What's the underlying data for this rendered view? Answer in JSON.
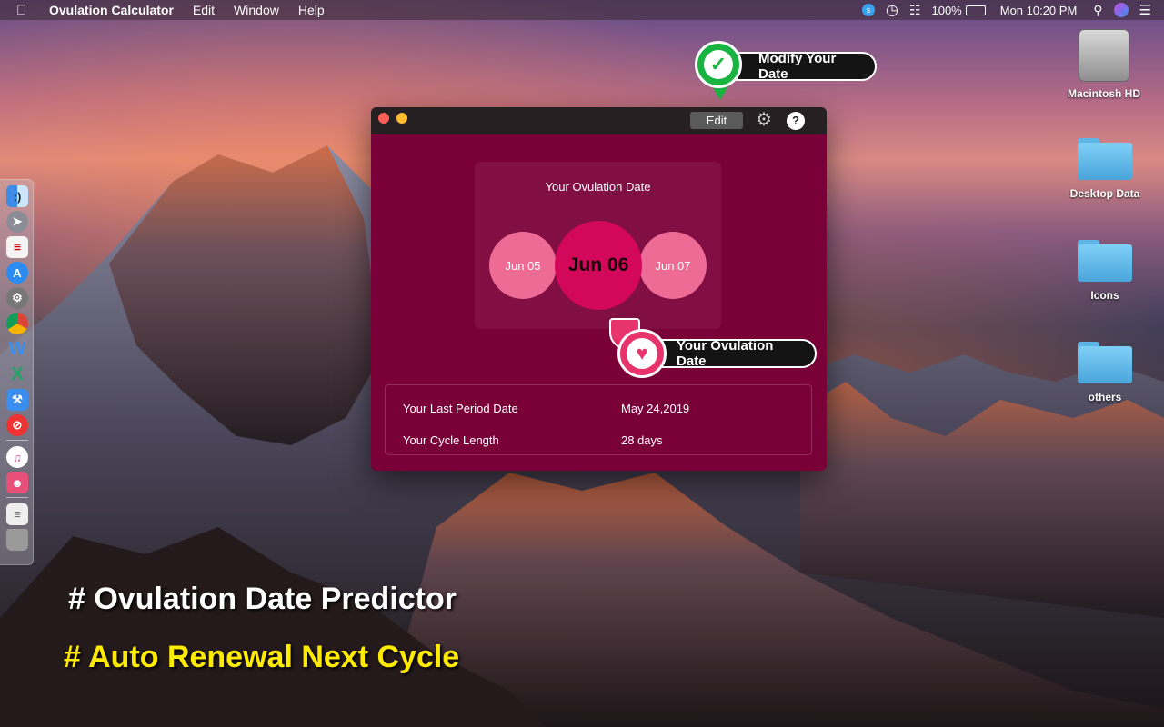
{
  "menubar": {
    "app_name": "Ovulation Calculator",
    "menus": [
      "Edit",
      "Window",
      "Help"
    ],
    "battery": "100%",
    "clock": "Mon 10:20 PM"
  },
  "desktop": {
    "items": [
      {
        "label": "Macintosh HD",
        "icon": "hard-drive-icon"
      },
      {
        "label": "Desktop Data",
        "icon": "folder-icon"
      },
      {
        "label": "Icons",
        "icon": "folder-icon"
      },
      {
        "label": "others",
        "icon": "folder-icon"
      }
    ]
  },
  "dock": {
    "apps": [
      "finder-icon",
      "launchpad-icon",
      "reminders-icon",
      "app-store-icon",
      "system-preferences-icon",
      "chrome-icon",
      "word-icon",
      "excel-icon",
      "xcode-icon",
      "blocker-icon",
      "itunes-icon",
      "game-icon",
      "document-icon",
      "trash-icon"
    ]
  },
  "window": {
    "toolbar": {
      "edit_label": "Edit",
      "help_label": "?"
    },
    "ovulation": {
      "title": "Your Ovulation Date",
      "prev": "Jun 05",
      "current": "Jun 06",
      "next": "Jun 07"
    },
    "info": {
      "last_period_label": "Your Last Period Date",
      "last_period_value": "May 24,2019",
      "cycle_label": "Your Cycle Length",
      "cycle_value": "28 days"
    }
  },
  "callouts": {
    "modify": "Modify Your Date",
    "ovulation": "Your Ovulation Date"
  },
  "promo": {
    "line1": "# Ovulation Date Predictor",
    "line2": "# Auto Renewal Next Cycle"
  },
  "colors": {
    "window_bg": "#7a0038",
    "main_circle": "#d4085b",
    "side_circle": "#ee6b95",
    "callout_green": "#18b341",
    "callout_pink": "#e8346d",
    "promo_yellow": "#ffeb00"
  }
}
